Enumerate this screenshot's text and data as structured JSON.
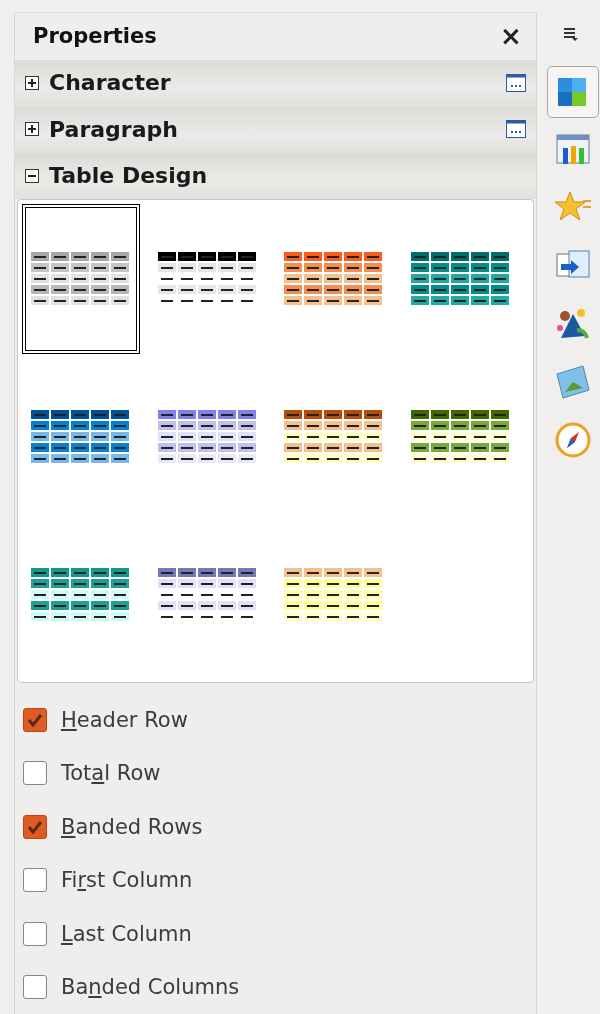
{
  "panel": {
    "title": "Properties",
    "close": "×"
  },
  "sections": [
    {
      "title": "Character",
      "expanded": false,
      "more_options": true
    },
    {
      "title": "Paragraph",
      "expanded": false,
      "more_options": true
    },
    {
      "title": "Table Design",
      "expanded": true,
      "more_options": false
    }
  ],
  "table_styles": [
    {
      "selected": true,
      "rows": [
        {
          "filled": true,
          "color": "#a8a8a8"
        },
        {
          "filled": true,
          "color": "#c4c4c4"
        },
        {
          "filled": true,
          "color": "#e2e2e2"
        },
        {
          "filled": true,
          "color": "#b8b8b8"
        },
        {
          "filled": true,
          "color": "#e2e2e2"
        }
      ]
    },
    {
      "selected": false,
      "rows": [
        {
          "filled": true,
          "color": "#000000"
        },
        {
          "filled": true,
          "color": "#e6e6e6"
        },
        {
          "filled": false
        },
        {
          "filled": true,
          "color": "#e6e6e6"
        },
        {
          "filled": false
        }
      ]
    },
    {
      "selected": false,
      "rows": [
        {
          "filled": true,
          "color": "#ff5a1a"
        },
        {
          "filled": true,
          "color": "#f58c50"
        },
        {
          "filled": true,
          "color": "#f5c090"
        },
        {
          "filled": true,
          "color": "#f58c50"
        },
        {
          "filled": true,
          "color": "#f5c090"
        }
      ]
    },
    {
      "selected": false,
      "rows": [
        {
          "filled": true,
          "color": "#006d6a"
        },
        {
          "filled": true,
          "color": "#00908c"
        },
        {
          "filled": true,
          "color": "#20aaa6"
        },
        {
          "filled": true,
          "color": "#00908c"
        },
        {
          "filled": true,
          "color": "#20aaa6"
        }
      ]
    },
    {
      "selected": false,
      "rows": [
        {
          "filled": true,
          "color": "#004d99"
        },
        {
          "filled": true,
          "color": "#0084d1"
        },
        {
          "filled": true,
          "color": "#7ab8e8"
        },
        {
          "filled": true,
          "color": "#0084d1"
        },
        {
          "filled": true,
          "color": "#7ab8e8"
        }
      ]
    },
    {
      "selected": false,
      "rows": [
        {
          "filled": true,
          "color": "#8080f0"
        },
        {
          "filled": true,
          "color": "#c0c0f0"
        },
        {
          "filled": true,
          "color": "#e0e0f8"
        },
        {
          "filled": true,
          "color": "#c0c0f0"
        },
        {
          "filled": true,
          "color": "#e8e8f8"
        }
      ]
    },
    {
      "selected": false,
      "rows": [
        {
          "filled": true,
          "color": "#b84a0a"
        },
        {
          "filled": true,
          "color": "#f5c090"
        },
        {
          "filled": true,
          "color": "#ffffc8"
        },
        {
          "filled": true,
          "color": "#f5c090"
        },
        {
          "filled": true,
          "color": "#ffffc8"
        }
      ]
    },
    {
      "selected": false,
      "rows": [
        {
          "filled": true,
          "color": "#3c6a00"
        },
        {
          "filled": true,
          "color": "#78a838"
        },
        {
          "filled": true,
          "color": "#ffffd0"
        },
        {
          "filled": true,
          "color": "#78a838"
        },
        {
          "filled": true,
          "color": "#ffffd0"
        }
      ]
    },
    {
      "selected": false,
      "rows": [
        {
          "filled": true,
          "color": "#13998a"
        },
        {
          "filled": true,
          "color": "#1aa095"
        },
        {
          "filled": true,
          "color": "#cffaf5"
        },
        {
          "filled": true,
          "color": "#1aa095"
        },
        {
          "filled": true,
          "color": "#cffaf5"
        }
      ]
    },
    {
      "selected": false,
      "rows": [
        {
          "filled": true,
          "color": "#7878b8"
        },
        {
          "filled": true,
          "color": "#e0e0f8"
        },
        {
          "filled": false
        },
        {
          "filled": true,
          "color": "#e0e0f8"
        },
        {
          "filled": false
        }
      ]
    },
    {
      "selected": false,
      "rows": [
        {
          "filled": true,
          "color": "#f5c090"
        },
        {
          "filled": true,
          "color": "#ffff9a"
        },
        {
          "filled": true,
          "color": "#ffffb0"
        },
        {
          "filled": true,
          "color": "#ffff9a"
        },
        {
          "filled": true,
          "color": "#ffffd0"
        }
      ]
    }
  ],
  "options": [
    {
      "key": "H",
      "rest": "eader Row",
      "checked": true
    },
    {
      "before": "Tot",
      "key": "a",
      "rest": "l Row",
      "checked": false
    },
    {
      "key": "B",
      "rest": "anded Rows",
      "checked": true
    },
    {
      "before": "Fi",
      "key": "r",
      "rest": "st Column",
      "checked": false
    },
    {
      "key": "L",
      "rest": "ast Column",
      "checked": false
    },
    {
      "before": "Ba",
      "key": "n",
      "rest": "ded Columns",
      "checked": false
    }
  ],
  "deck_tabs": [
    {
      "kind": "styles",
      "selected": true
    },
    {
      "kind": "gallery",
      "selected": false
    },
    {
      "kind": "star",
      "selected": false
    },
    {
      "kind": "import",
      "selected": false
    },
    {
      "kind": "animation",
      "selected": false
    },
    {
      "kind": "picture",
      "selected": false
    },
    {
      "kind": "navigator",
      "selected": false
    }
  ]
}
